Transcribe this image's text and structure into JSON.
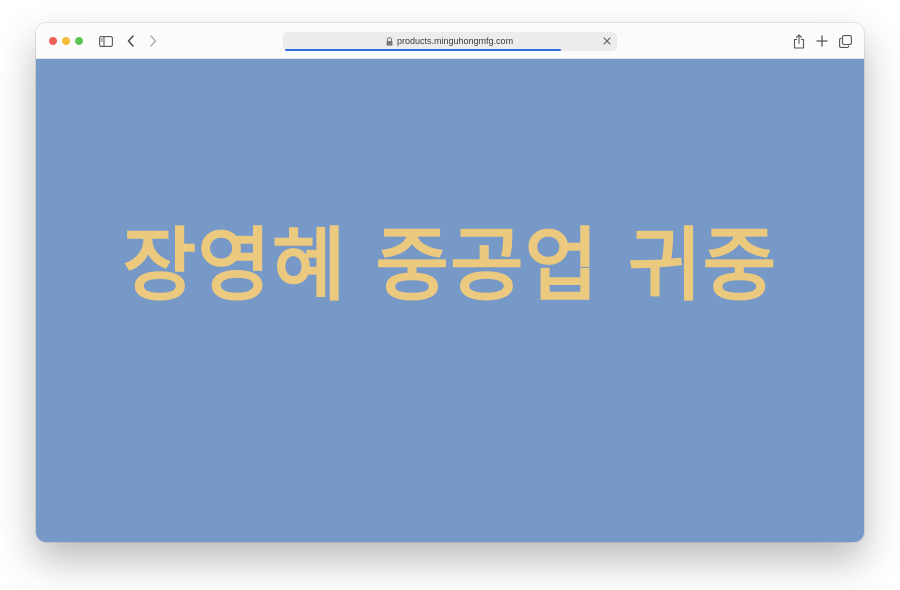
{
  "browser": {
    "url": "products.minguhongmfg.com",
    "traffic_lights": {
      "close_color": "#ee5f58",
      "minimize_color": "#f6bd3b",
      "maximize_color": "#5fc453"
    },
    "loading_progress_color": "#2f6fe0",
    "icons": {
      "sidebar": "sidebar-icon",
      "back": "chevron-left-icon",
      "forward": "chevron-right-icon",
      "lock": "lock-icon",
      "close_tab": "close-icon",
      "share": "share-icon",
      "new_tab": "plus-icon",
      "tabs_overview": "tabs-overview-icon"
    }
  },
  "page": {
    "background_color": "#7799c8",
    "headline": "장영혜 중공업 귀중",
    "headline_color": "#ebc97e"
  }
}
